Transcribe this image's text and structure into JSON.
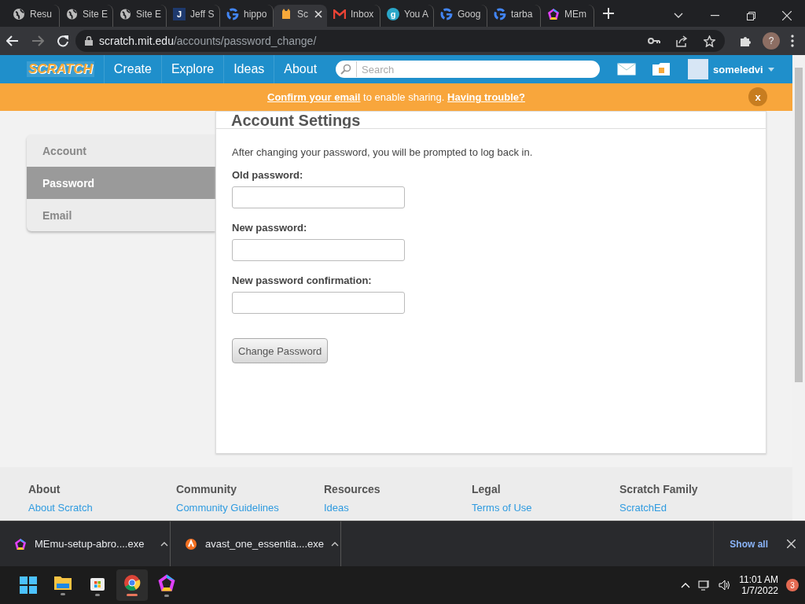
{
  "browser": {
    "tabs": [
      {
        "title": "Resu",
        "kind": "globe",
        "selected": false
      },
      {
        "title": "Site E",
        "kind": "globe",
        "selected": false
      },
      {
        "title": "Site E",
        "kind": "globe",
        "selected": false
      },
      {
        "title": "Jeff S",
        "kind": "letter",
        "letter": "J",
        "selected": false
      },
      {
        "title": "hippo",
        "kind": "google",
        "selected": false
      },
      {
        "title": "Sc",
        "kind": "scratch",
        "selected": true
      },
      {
        "title": "Inbox",
        "kind": "mail",
        "selected": false
      },
      {
        "title": "You A",
        "kind": "round",
        "letter": "g",
        "selected": false
      },
      {
        "title": "Goog",
        "kind": "google",
        "selected": false
      },
      {
        "title": "tarba",
        "kind": "google",
        "selected": false
      },
      {
        "title": "MEm",
        "kind": "memu",
        "selected": false
      }
    ],
    "address": {
      "host": "scratch.mit.edu",
      "path": "/accounts/password_change/"
    },
    "profile_initial": "?"
  },
  "site": {
    "logo": "SCRATCH",
    "nav": [
      "Create",
      "Explore",
      "Ideas",
      "About"
    ],
    "search": {
      "placeholder": "Search"
    },
    "username": "someledvi"
  },
  "banner": {
    "link1": "Confirm your email",
    "middle": " to enable sharing. ",
    "link2": "Having trouble?",
    "close": "x"
  },
  "settings": {
    "title": "Account Settings",
    "menu": [
      {
        "label": "Account",
        "selected": false
      },
      {
        "label": "Password",
        "selected": true
      },
      {
        "label": "Email",
        "selected": false
      }
    ],
    "intro": "After changing your password, you will be prompted to log back in.",
    "fields": [
      {
        "label": "Old password:"
      },
      {
        "label": "New password:"
      },
      {
        "label": "New password confirmation:"
      }
    ],
    "submit": "Change Password"
  },
  "footer": {
    "columns": [
      {
        "heading": "About",
        "link": "About Scratch"
      },
      {
        "heading": "Community",
        "link": "Community Guidelines"
      },
      {
        "heading": "Resources",
        "link": "Ideas"
      },
      {
        "heading": "Legal",
        "link": "Terms of Use"
      },
      {
        "heading": "Scratch Family",
        "link": "ScratchEd"
      }
    ]
  },
  "downloads": {
    "items": [
      {
        "name": "MEmu-setup-abro....exe",
        "kind": "memu"
      },
      {
        "name": "avast_one_essentia....exe",
        "kind": "avast"
      }
    ],
    "show_all": "Show all"
  },
  "taskbar": {
    "apps": [
      {
        "kind": "explorer",
        "active": false
      },
      {
        "kind": "store",
        "active": false
      },
      {
        "kind": "chrome",
        "active": true
      },
      {
        "kind": "memu",
        "active": false
      }
    ],
    "time": "11:01 AM",
    "date": "1/7/2022",
    "notifications": "3"
  }
}
